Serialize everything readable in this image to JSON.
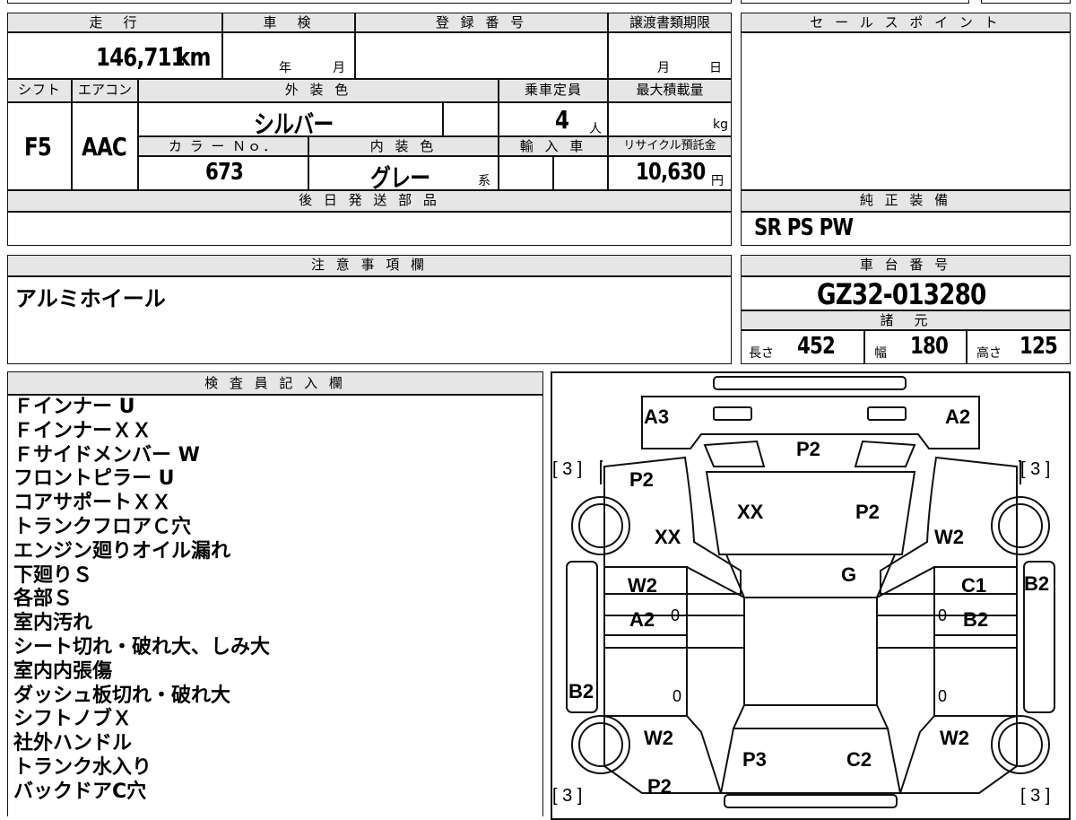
{
  "basic": {
    "mileage_header": "走　行",
    "mileage_value": "146,711",
    "mileage_unit": "km",
    "inspection_header": "車　検",
    "inspection_year": "年",
    "inspection_month": "月",
    "registration_header": "登 録 番 号",
    "transfer_header": "譲渡書類期限",
    "transfer_month": "月",
    "transfer_day": "日",
    "shift_header": "シフト",
    "shift_value": "F5",
    "ac_header": "エアコン",
    "ac_value": "AAC",
    "exterior_header": "外 装 色",
    "exterior_value": "シルバー",
    "capacity_header": "乗車定員",
    "capacity_value": "4",
    "capacity_unit": "人",
    "maxload_header": "最大積載量",
    "maxload_unit": "kg",
    "color_no_header": "カ ラ ー Ｎｏ．",
    "color_no_value": "673",
    "interior_header": "内 装 色",
    "interior_value": "グレー",
    "interior_suffix": "系",
    "import_header": "輸 入 車",
    "recycle_header": "リサイクル預託金",
    "recycle_value": "10,630",
    "recycle_unit": "円",
    "later_parts_header": "後 日 発 送 部 品"
  },
  "sales": {
    "header": "セ ー ル ス ポ イ ン ト"
  },
  "equipment": {
    "header": "純 正 装 備",
    "value": "SR PS PW"
  },
  "notes": {
    "header": "注 意 事 項 欄",
    "value": "アルミホイール"
  },
  "chassis": {
    "header": "車 台 番 号",
    "value": "GZ32-013280"
  },
  "specs": {
    "header": "諸　元",
    "length_label": "長さ",
    "length_value": "452",
    "width_label": "幅",
    "width_value": "180",
    "height_label": "高さ",
    "height_value": "125"
  },
  "inspector": {
    "header": "検 査 員 記 入 欄",
    "lines": [
      "Ｆインナー U",
      "ＦインナーＸＸ",
      "Ｆサイドメンバー W",
      "フロントピラー U",
      "コアサポートＸＸ",
      "トランクフロアＣ穴",
      "エンジン廻りオイル漏れ",
      "下廻りＳ",
      "各部Ｓ",
      "室内汚れ",
      "シート切れ・破れ大、しみ大",
      "室内内張傷",
      "ダッシュ板切れ・破れ大",
      "シフトノブＸ",
      "社外ハンドル",
      "トランク水入り",
      "バックドアC穴"
    ]
  },
  "diagram": {
    "tire_label": "[ 3 ]",
    "zero": "0",
    "labels": {
      "a3": "A3",
      "a2_top": "A2",
      "p2_top": "P2",
      "p2_fl": "P2",
      "xx_hood": "XX",
      "p2_hood": "P2",
      "xx_fl": "XX",
      "w2_fr": "W2",
      "g": "G",
      "w2_ld": "W2",
      "a2_ld": "A2",
      "c1": "C1",
      "b2_rd": "B2",
      "b2_rside": "B2",
      "b2_lside": "B2",
      "w2_rl": "W2",
      "w2_rr": "W2",
      "p3": "P3",
      "c2": "C2",
      "p2_bottom": "P2"
    }
  }
}
